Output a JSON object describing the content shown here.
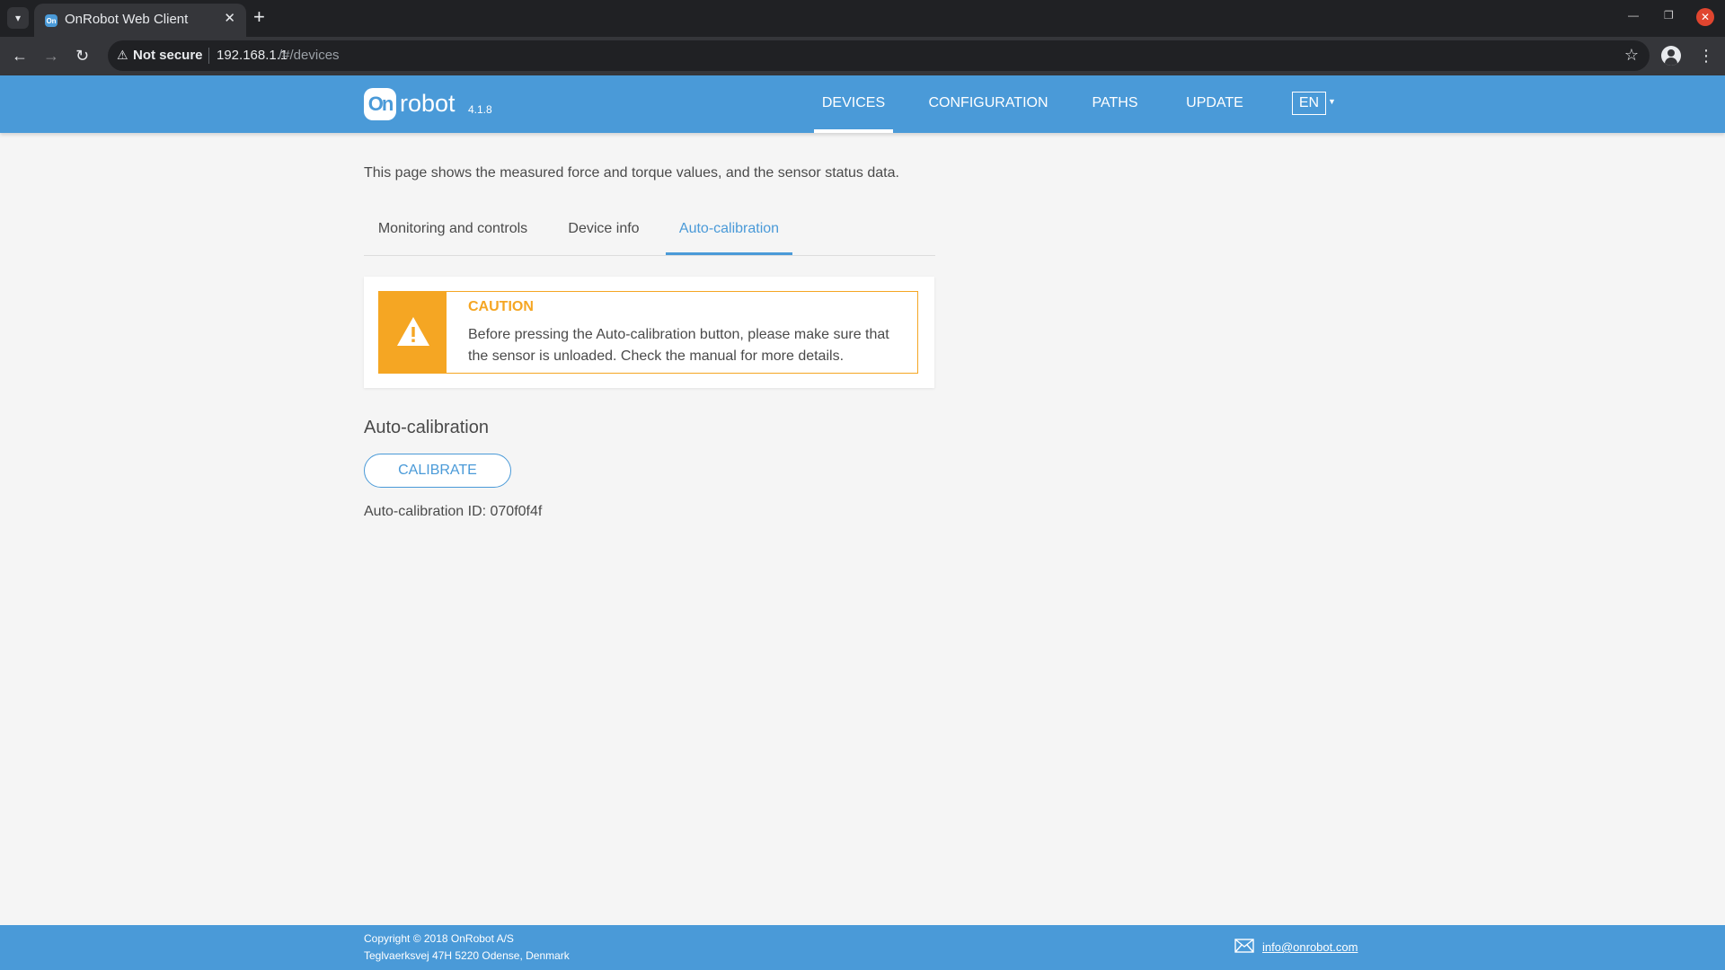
{
  "browser": {
    "tab_title": "OnRobot Web Client",
    "favicon_text": "On",
    "close_glyph": "✕",
    "new_tab_glyph": "+",
    "security_label": "Not secure",
    "url_host": "192.168.1.1",
    "url_path": "/#/devices"
  },
  "app": {
    "logo_mark": "On",
    "logo_text": "robot",
    "version": "4.1.8",
    "nav": [
      {
        "label": "DEVICES",
        "active": true
      },
      {
        "label": "CONFIGURATION",
        "active": false
      },
      {
        "label": "PATHS",
        "active": false
      },
      {
        "label": "UPDATE",
        "active": false
      }
    ],
    "language": "EN"
  },
  "page": {
    "intro": "This page shows the measured force and torque values, and the sensor status data.",
    "tabs": [
      {
        "label": "Monitoring and controls",
        "active": false
      },
      {
        "label": "Device info",
        "active": false
      },
      {
        "label": "Auto-calibration",
        "active": true
      }
    ],
    "caution": {
      "title": "CAUTION",
      "text": "Before pressing the Auto-calibration button, please make sure that the sensor is unloaded. Check the manual for more details."
    },
    "section_title": "Auto-calibration",
    "calibrate_label": "CALIBRATE",
    "calibration_id": "Auto-calibration ID: 070f0f4f"
  },
  "footer": {
    "copyright": "Copyright © 2018 OnRobot A/S",
    "address": "Teglvaerksvej 47H 5220 Odense, Denmark",
    "email": "info@onrobot.com"
  },
  "colors": {
    "brand_blue": "#4a9ad8",
    "caution_orange": "#f5a623",
    "page_background": "#f5f5f5"
  },
  "icons": [
    "chevron-down-icon",
    "close-icon",
    "plus-icon",
    "back-arrow-icon",
    "forward-arrow-icon",
    "reload-icon",
    "warning-triangle-icon",
    "star-icon",
    "profile-icon",
    "kebab-menu-icon",
    "mail-icon"
  ]
}
